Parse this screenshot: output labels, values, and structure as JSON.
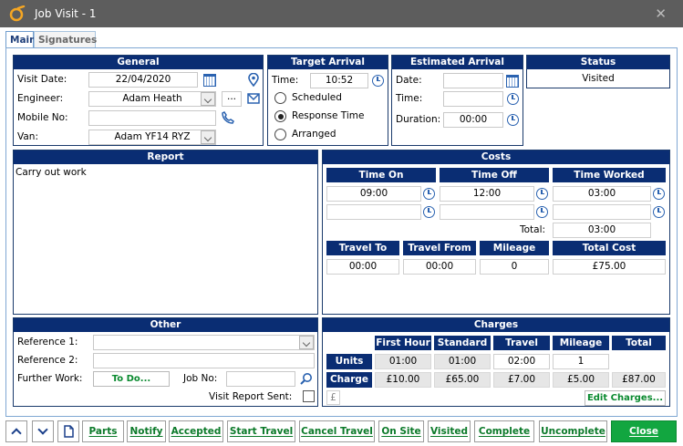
{
  "window": {
    "title": "Job Visit - 1"
  },
  "tabs": [
    "Main",
    "Signatures"
  ],
  "general": {
    "header": "General",
    "visit_date_label": "Visit Date:",
    "visit_date": "22/04/2020",
    "engineer_label": "Engineer:",
    "engineer": "Adam Heath",
    "more_label": "...",
    "mobile_label": "Mobile No:",
    "mobile": "",
    "van_label": "Van:",
    "van": "Adam YF14 RYZ"
  },
  "target_arrival": {
    "header": "Target Arrival",
    "time_label": "Time:",
    "time": "10:52",
    "options": [
      "Scheduled",
      "Response Time",
      "Arranged"
    ],
    "selected": "Response Time"
  },
  "estimated_arrival": {
    "header": "Estimated Arrival",
    "date_label": "Date:",
    "date": "",
    "time_label": "Time:",
    "time": "",
    "duration_label": "Duration:",
    "duration": "00:00"
  },
  "status": {
    "header": "Status",
    "value": "Visited"
  },
  "report": {
    "header": "Report",
    "text": "Carry out work"
  },
  "costs": {
    "header": "Costs",
    "col_time_on": "Time On",
    "col_time_off": "Time Off",
    "col_time_worked": "Time Worked",
    "row1": {
      "time_on": "09:00",
      "time_off": "12:00",
      "time_worked": "03:00"
    },
    "row2": {
      "time_on": "",
      "time_off": "",
      "time_worked": ""
    },
    "total_label": "Total:",
    "total": "03:00",
    "col_travel_to": "Travel To",
    "col_travel_from": "Travel From",
    "col_mileage": "Mileage",
    "col_total_cost": "Total Cost",
    "travel_to": "00:00",
    "travel_from": "00:00",
    "mileage": "0",
    "total_cost": "£75.00"
  },
  "other": {
    "header": "Other",
    "ref1_label": "Reference 1:",
    "ref1": "",
    "ref2_label": "Reference 2:",
    "ref2": "",
    "further_work_label": "Further Work:",
    "todo_button": "To Do...",
    "job_no_label": "Job No:",
    "job_no": "",
    "visit_report_label": "Visit Report Sent:"
  },
  "charges": {
    "header": "Charges",
    "columns": [
      "First Hour",
      "Standard",
      "Travel",
      "Mileage",
      "Total"
    ],
    "units_label": "Units",
    "units": [
      "01:00",
      "01:00",
      "02:00",
      "1",
      ""
    ],
    "charge_label": "Charge",
    "charge": [
      "£10.00",
      "£65.00",
      "£7.00",
      "£5.00",
      "£87.00"
    ],
    "currency_symbol": "£",
    "edit_button": "Edit Charges..."
  },
  "bottom": {
    "parts": "Parts",
    "notify": "Notify",
    "accepted": "Accepted",
    "start_travel": "Start Travel",
    "cancel_travel": "Cancel Travel",
    "on_site": "On Site",
    "visited": "Visited",
    "complete": "Complete",
    "uncomplete": "Uncomplete",
    "close": "Close"
  },
  "colors": {
    "header_blue": "#0a2d73",
    "action_green": "#0c7a2a",
    "close_green": "#12a640",
    "title_bar": "#5d5d5d",
    "app_icon_orange": "#f5a623"
  }
}
